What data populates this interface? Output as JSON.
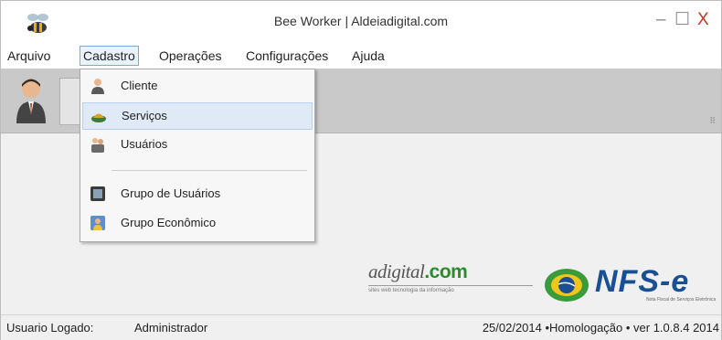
{
  "window": {
    "title": "Bee Worker | Aldeiadigital.com",
    "app_icon": "bee-icon",
    "controls": {
      "minimize": "–",
      "maximize": "☐",
      "close": "X"
    }
  },
  "menubar": {
    "items": [
      "Arquivo",
      "Cadastro",
      "Operações",
      "Configurações",
      "Ajuda"
    ],
    "active": "Cadastro"
  },
  "toolbar": {
    "icon": "user-icon"
  },
  "cadastro_menu": {
    "items": [
      {
        "label": "Cliente",
        "icon": "client-icon"
      },
      {
        "label": "Serviços",
        "icon": "services-icon",
        "highlighted": true
      },
      {
        "label": "Usuários",
        "icon": "users-icon"
      },
      {
        "label": "Grupo de Usuários",
        "icon": "user-group-icon"
      },
      {
        "label": "Grupo Econômico",
        "icon": "economic-group-icon"
      }
    ]
  },
  "logos": {
    "aldeia": {
      "name": "adigital",
      "suffix": ".com",
      "tagline": "sites web tecnologia da informação"
    },
    "nfse": {
      "name": "NFS-e",
      "tagline": "Nota Fiscal de Serviços Eletrônica"
    }
  },
  "statusbar": {
    "user_label": "Usuario Logado:",
    "user_name": "Administrador",
    "info": "25/02/2014 •Homologação • ver 1.0.8.4 2014"
  },
  "colors": {
    "menu_active_border": "#7fa7d6",
    "toolbar_bg": "#c9c9c9",
    "nfse_blue": "#1b4f93",
    "aldeia_green": "#2d8a2d"
  }
}
